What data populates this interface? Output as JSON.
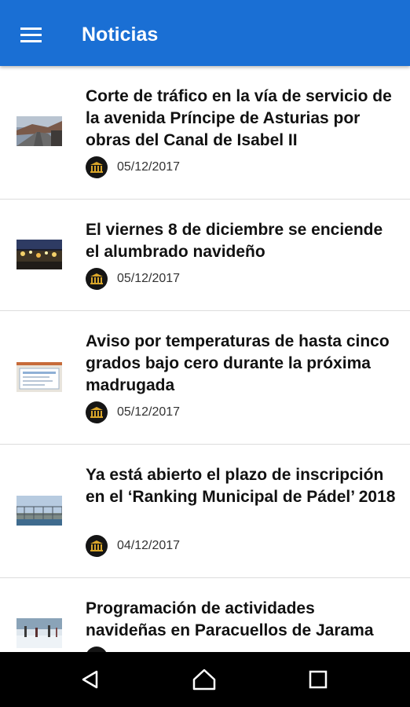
{
  "app_bar": {
    "menu_icon": "hamburger-menu-icon",
    "title": "Noticias",
    "color": "#1a6fd4"
  },
  "news": [
    {
      "title": "Corte de tráfico en la vía de servicio de la avenida Príncipe de Asturias por obras del Canal de Isabel II",
      "date": "05/12/2017",
      "thumbnail": "road-photo",
      "source_icon": "town-hall-icon"
    },
    {
      "title": "El viernes 8 de diciembre se enciende el alumbrado navideño",
      "date": "05/12/2017",
      "thumbnail": "christmas-lights-photo",
      "source_icon": "town-hall-icon"
    },
    {
      "title": "Aviso por temperaturas de hasta cinco grados bajo cero durante la próxima madrugada",
      "date": "05/12/2017",
      "thumbnail": "weather-warning-photo",
      "source_icon": "town-hall-icon"
    },
    {
      "title": "Ya está abierto el plazo de inscripción  en el ‘Ranking Municipal de Pádel’ 2018",
      "date": "04/12/2017",
      "thumbnail": "padel-court-photo",
      "source_icon": "town-hall-icon"
    },
    {
      "title": "Programación de actividades navideñas en Paracuellos de Jarama",
      "date": "",
      "thumbnail": "ice-rink-photo",
      "source_icon": "town-hall-icon"
    }
  ],
  "nav_bar": {
    "back_icon": "back-triangle-icon",
    "home_icon": "home-icon",
    "recents_icon": "recents-square-icon"
  }
}
